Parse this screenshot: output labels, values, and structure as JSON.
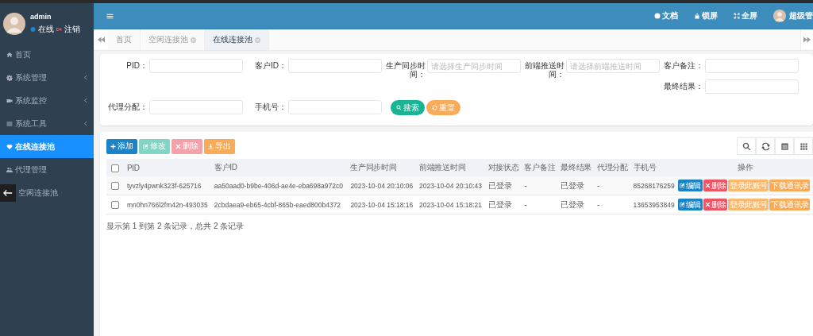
{
  "sidebar": {
    "user": {
      "name": "admin",
      "status": "在线",
      "logout": "注销"
    },
    "items": [
      {
        "label": "首页",
        "expandable": false,
        "selected": false
      },
      {
        "label": "系统管理",
        "expandable": true,
        "selected": false
      },
      {
        "label": "系统监控",
        "expandable": true,
        "selected": false
      },
      {
        "label": "系统工具",
        "expandable": true,
        "selected": false
      },
      {
        "label": "在线连接池",
        "expandable": false,
        "selected": true
      },
      {
        "label": "代理管理",
        "expandable": false,
        "selected": false
      },
      {
        "label": "空闲连接池",
        "expandable": false,
        "selected": false
      }
    ]
  },
  "header": {
    "actions": [
      {
        "label": "文档"
      },
      {
        "label": "锁屏"
      },
      {
        "label": "全屏"
      }
    ],
    "user_name": "超级管"
  },
  "tabs": [
    {
      "label": "首页",
      "closable": false,
      "selected": false
    },
    {
      "label": "空闲连接池",
      "closable": true,
      "selected": false
    },
    {
      "label": "在线连接池",
      "closable": true,
      "selected": true
    }
  ],
  "search_form": {
    "fields": [
      {
        "label": "PID："
      },
      {
        "label": "客户ID："
      },
      {
        "label": "生产同步时间：",
        "placeholder": "请选择生产同步时间"
      },
      {
        "label": "前端推送时间：",
        "placeholder": "请选择前端推送时间"
      },
      {
        "label": "客户备注："
      },
      {
        "label": "最终结果："
      },
      {
        "label": "代理分配："
      },
      {
        "label": "手机号："
      }
    ],
    "buttons": [
      {
        "label": "搜索",
        "kind": "search"
      },
      {
        "label": "重置",
        "kind": "reset"
      }
    ]
  },
  "toolbar": {
    "buttons": [
      {
        "label": "添加",
        "kind": "add",
        "disabled": false
      },
      {
        "label": "修改",
        "kind": "edit",
        "disabled": true
      },
      {
        "label": "删除",
        "kind": "delete",
        "disabled": true
      },
      {
        "label": "导出",
        "kind": "export",
        "disabled": false
      }
    ]
  },
  "table": {
    "all_checked": false,
    "columns": [
      "PID",
      "客户ID",
      "生产同步时间",
      "前端推送时间",
      "对接状态",
      "客户备注",
      "最终结果",
      "代理分配",
      "手机号",
      "操作"
    ],
    "rows": [
      {
        "checked": false,
        "cells": [
          "tyvzly4pwnk323f-625716",
          "aa50aad0-b9be-406d-ae4e-eba698a972c0",
          "2023-10-04 20:10:06",
          "2023-10-04 20:10:43",
          "已登录",
          "-",
          "已登录",
          "-",
          "85268176259"
        ],
        "actions": [
          {
            "label": "编辑",
            "kind": "edit"
          },
          {
            "label": "删除",
            "kind": "delete"
          },
          {
            "label": "登录此账号",
            "kind": "login"
          },
          {
            "label": "下载通讯录",
            "kind": "download"
          }
        ]
      },
      {
        "checked": false,
        "cells": [
          "mn0hn766l2fm42n-493035",
          "2cbdaea9-eb65-4cbf-865b-eaed800b4372",
          "2023-10-04 15:18:16",
          "2023-10-04 15:18:21",
          "已登录",
          "-",
          "已登录",
          "-",
          "13653953849"
        ],
        "actions": [
          {
            "label": "编辑",
            "kind": "edit"
          },
          {
            "label": "删除",
            "kind": "delete"
          },
          {
            "label": "登录此账号",
            "kind": "login"
          },
          {
            "label": "下载通讯录",
            "kind": "download"
          }
        ]
      }
    ]
  },
  "pagination_info": "显示第 1 到第 2 条记录，总共 2 条记录"
}
